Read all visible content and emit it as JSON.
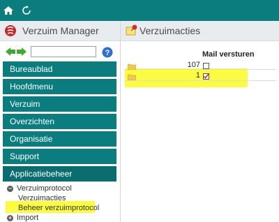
{
  "app": {
    "title": "Verzuim Manager"
  },
  "page": {
    "title": "Verzuimacties"
  },
  "search": {
    "value": "",
    "placeholder": ""
  },
  "nav": {
    "items": [
      {
        "label": "Bureaublad"
      },
      {
        "label": "Hoofdmenu"
      },
      {
        "label": "Verzuim"
      },
      {
        "label": "Overzichten"
      },
      {
        "label": "Organisatie"
      },
      {
        "label": "Support"
      },
      {
        "label": "Applicatiebeheer"
      }
    ],
    "sub": {
      "verzuimprotocol": "Verzuimprotocol",
      "verzuimacties": "Verzuimacties",
      "beheer": "Beheer verzuimprotocol",
      "import": "Import"
    }
  },
  "table": {
    "header": "Mail versturen",
    "rows": [
      {
        "count": "107",
        "mail": false
      },
      {
        "count": "1",
        "mail": true
      }
    ]
  },
  "colors": {
    "teal": "#0b7d7f",
    "highlight": "#fbfb3f",
    "red": "#d32f2f"
  },
  "icons": [
    "home-icon",
    "refresh-icon",
    "app-logo-icon",
    "memo-pin-icon",
    "arrow-left-icon",
    "arrow-right-icon",
    "help-icon",
    "folder-icon",
    "mail-checkbox-icon"
  ]
}
